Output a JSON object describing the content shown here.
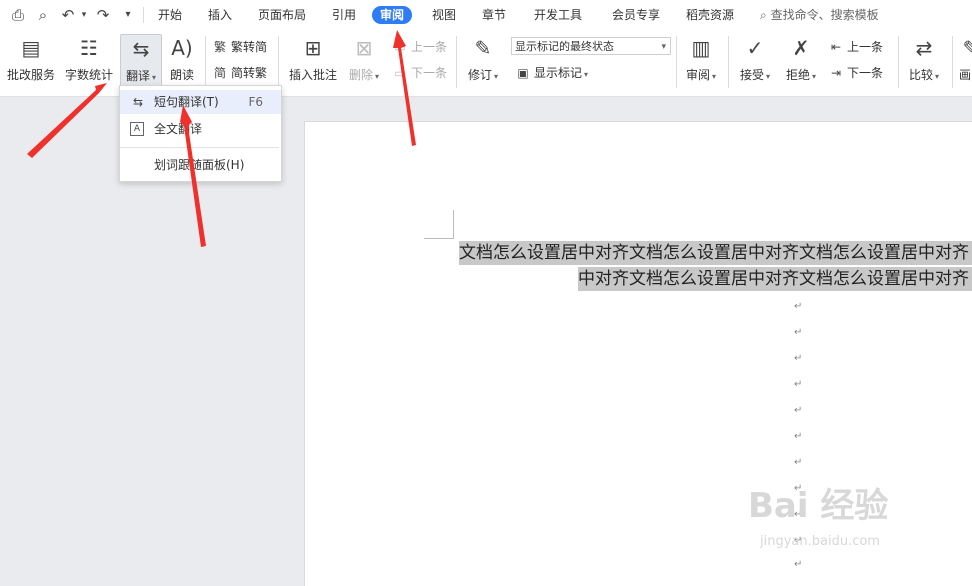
{
  "quick_access": [
    {
      "name": "print-icon",
      "glyph": "⎙"
    },
    {
      "name": "print-preview-icon",
      "glyph": "🔍"
    },
    {
      "name": "undo-icon",
      "glyph": "↶"
    },
    {
      "name": "redo-icon",
      "glyph": "↷"
    },
    {
      "name": "more-icon",
      "glyph": "▾"
    }
  ],
  "tabs": [
    "开始",
    "插入",
    "页面布局",
    "引用",
    "审阅",
    "视图",
    "章节",
    "开发工具",
    "会员专享",
    "稻壳资源"
  ],
  "active_tab": "审阅",
  "search": {
    "placeholder": "查找命令、搜索模板",
    "icon": "search-icon"
  },
  "ribbon": {
    "proofread": "批改服务",
    "word_count": "字数统计",
    "translate": "翻译",
    "read_aloud": "朗读",
    "trad_to_simp": "繁转简",
    "simp_to_trad": "简转繁",
    "insert_comment": "插入批注",
    "delete": "删除",
    "prev_comment": "上一条",
    "next_comment": "下一条",
    "track_changes": "修订",
    "markup_state": "显示标记的最终状态",
    "show_markup": "显示标记",
    "review": "审阅",
    "accept": "接受",
    "reject": "拒绝",
    "prev_change": "上一条",
    "next_change": "下一条",
    "compare": "比较",
    "partial": "画"
  },
  "translate_menu": {
    "items": [
      {
        "label": "短句翻译(T)",
        "shortcut": "F6",
        "icon": "short-translate-icon"
      },
      {
        "label": "全文翻译",
        "shortcut": "",
        "icon": "full-translate-icon"
      },
      {
        "label": "划词跟随面板(H)",
        "shortcut": "",
        "icon": ""
      }
    ]
  },
  "document": {
    "line1": "文档怎么设置居中对齐文档怎么设置居中对齐文档怎么设置居中对齐",
    "line2": "中对齐文档怎么设置居中对齐文档怎么设置居中对齐",
    "paragraph_mark": "↵"
  },
  "watermark": {
    "logo": "Bai 经验",
    "url": "jingyan.baidu.com"
  },
  "colors": {
    "accent": "#2f7cf6",
    "arrow": "#f0302a"
  }
}
